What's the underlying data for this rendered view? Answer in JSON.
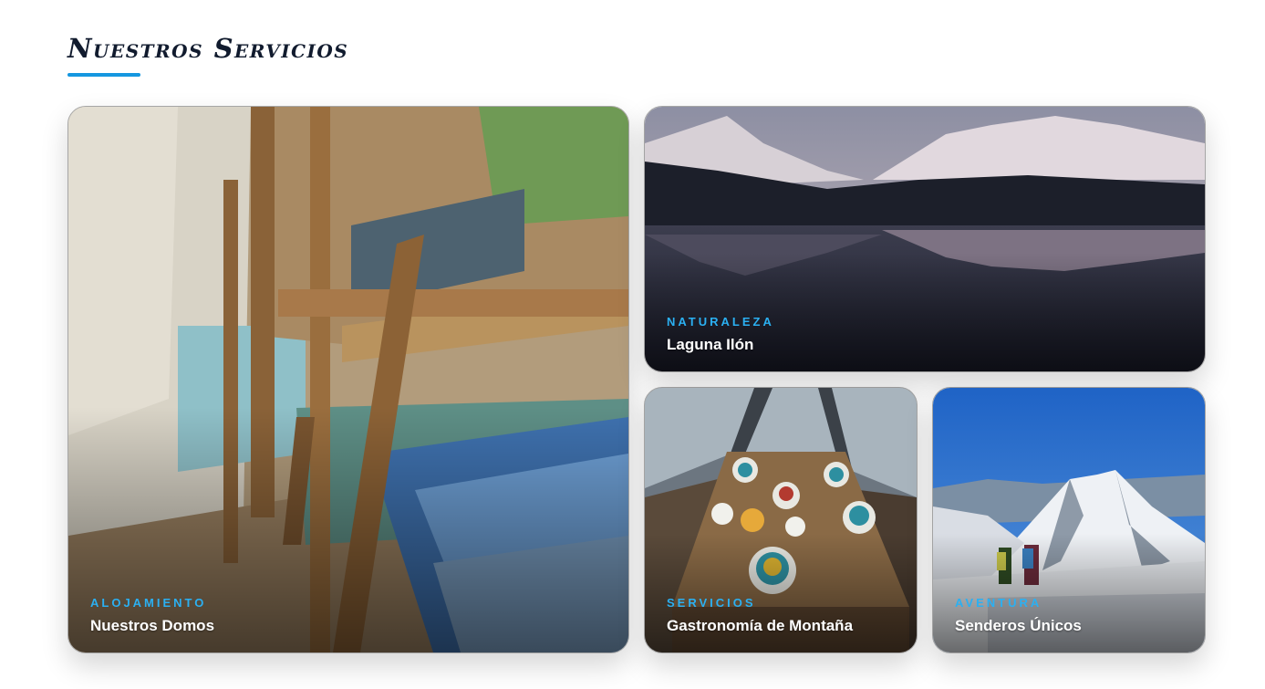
{
  "section": {
    "title": "Nuestros Servicios"
  },
  "colors": {
    "accent": "#1597e0",
    "category_text": "#2bb0f2",
    "title_text": "#111b2e"
  },
  "cards": [
    {
      "category": "ALOJAMIENTO",
      "title": "Nuestros Domos",
      "image": "dome-bunk-beds-photo"
    },
    {
      "category": "NATURALEZA",
      "title": "Laguna Ilón",
      "image": "mountain-lake-reflection-photo"
    },
    {
      "category": "SERVICIOS",
      "title": "Gastronomía de Montaña",
      "image": "breakfast-table-dome-photo"
    },
    {
      "category": "AVENTURA",
      "title": "Senderos Únicos",
      "image": "snowy-peak-hikers-photo"
    }
  ]
}
